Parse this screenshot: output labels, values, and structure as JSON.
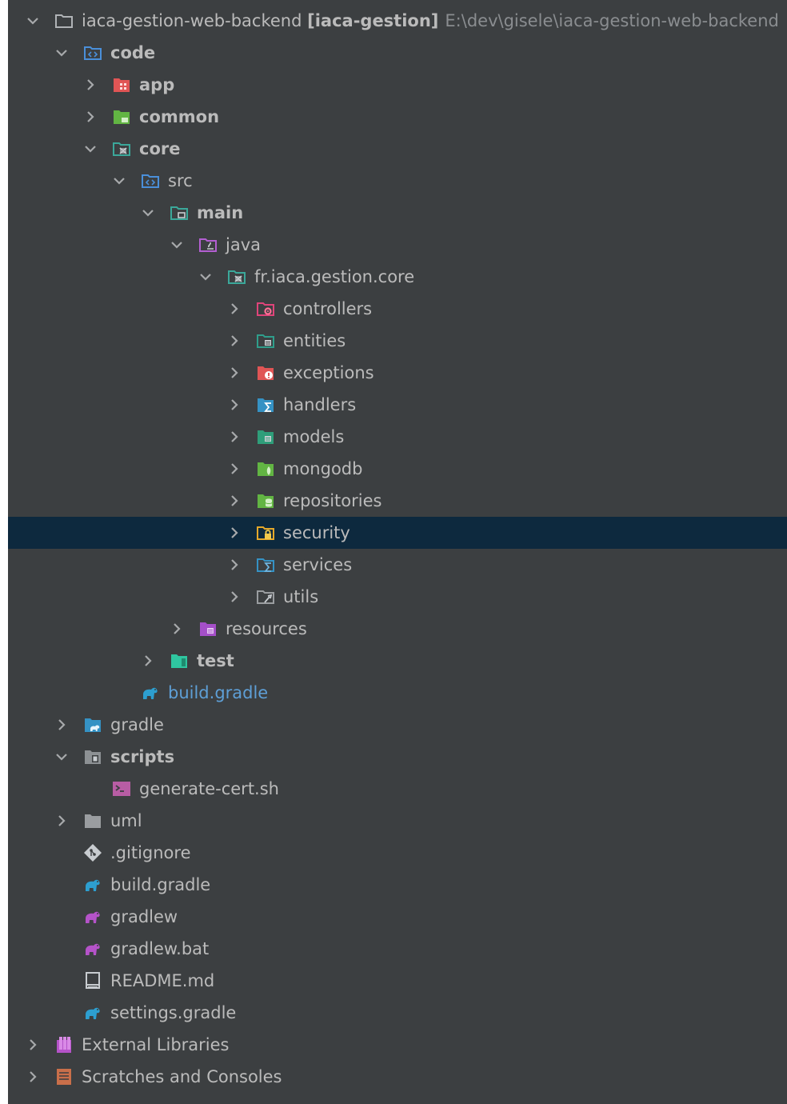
{
  "tree": {
    "root": {
      "name": "iaca-gestion-web-backend",
      "module": "[iaca-gestion]",
      "path": "E:\\dev\\gisele\\iaca-gestion-web-backend"
    },
    "code": "code",
    "app": "app",
    "common": "common",
    "core": "core",
    "src": "src",
    "main": "main",
    "java": "java",
    "package": "fr.iaca.gestion.core",
    "controllers": "controllers",
    "entities": "entities",
    "exceptions": "exceptions",
    "handlers": "handlers",
    "models": "models",
    "mongodb": "mongodb",
    "repositories": "repositories",
    "security": "security",
    "services": "services",
    "utils": "utils",
    "resources": "resources",
    "test": "test",
    "core_build_gradle": "build.gradle",
    "gradle": "gradle",
    "scripts": "scripts",
    "generate_cert": "generate-cert.sh",
    "uml": "uml",
    "gitignore": ".gitignore",
    "build_gradle": "build.gradle",
    "gradlew": "gradlew",
    "gradlew_bat": "gradlew.bat",
    "readme": "README.md",
    "settings_gradle": "settings.gradle",
    "external_libraries": "External Libraries",
    "scratches": "Scratches and Consoles"
  },
  "colors": {
    "panel_bg": "#3c3f41",
    "selected_row": "#0d293e",
    "text": "#bbbbbb",
    "modified_text": "#5e9fd6",
    "hint_text": "#8a8d90"
  },
  "selected_item": "security"
}
